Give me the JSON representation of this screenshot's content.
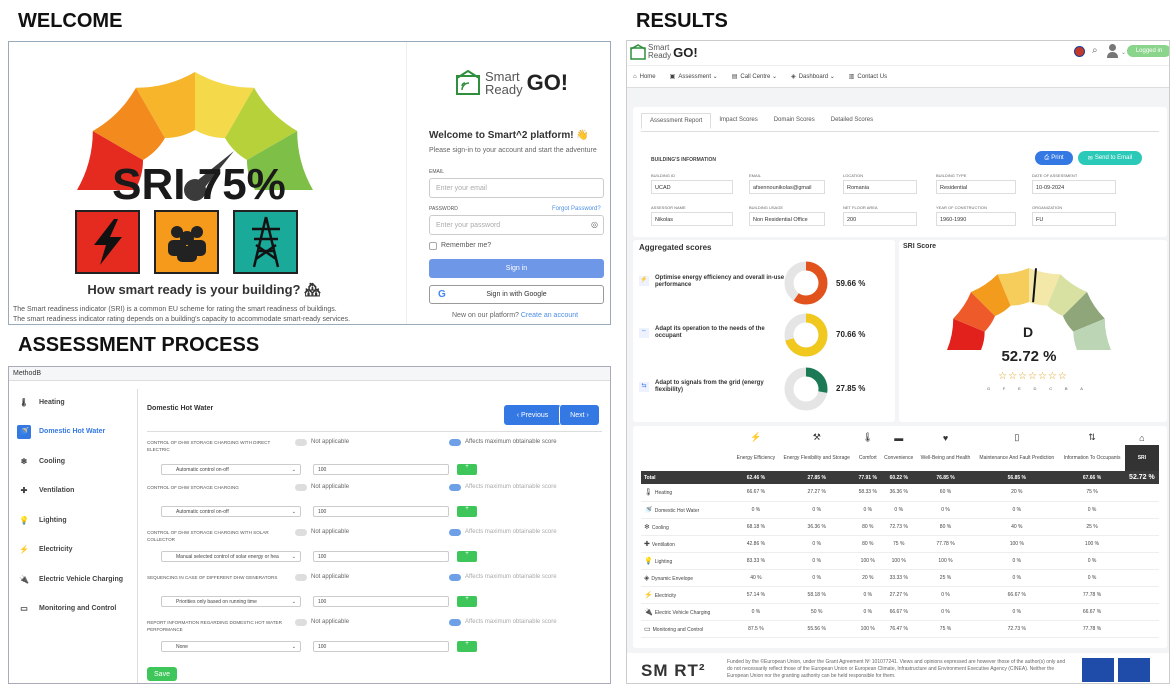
{
  "sections": {
    "welcome": "WELCOME",
    "assessment": "ASSESSMENT PROCESS",
    "results": "RESULTS"
  },
  "welcome": {
    "sri_label": "SRI 75%",
    "sri_value": 0.75,
    "question": "How smart ready is your building? 🏘",
    "caption1": "The Smart readiness indicator (SRI) is a common EU scheme for rating the smart readiness of buildings.",
    "caption2": "The smart readiness indicator rating depends on a building's capacity to accommodate smart-ready services.",
    "logo_smart": "Smart",
    "logo_ready": "Ready",
    "logo_go": "GO!",
    "heading": "Welcome to Smart^2 platform! 👋",
    "subheading": "Please sign-in to your account and start the adventure",
    "email_label": "EMAIL",
    "email_placeholder": "Enter your email",
    "password_label": "PASSWORD",
    "forgot": "Forgot Password?",
    "password_placeholder": "Enter your password",
    "remember": "Remember me?",
    "signin": "Sign in",
    "google": "Sign in with Google",
    "new_text": "New on our platform?",
    "create": "Create an account",
    "colors": {
      "red": "#e52b1f",
      "orange": "#f59a1b",
      "teal": "#1aaa9a",
      "blue": "#4d8ee8"
    }
  },
  "assessment": {
    "method": "MethodB",
    "sidebar": [
      "Heating",
      "Domestic Hot Water",
      "Cooling",
      "Ventilation",
      "Lighting",
      "Electricity",
      "Electric Vehicle Charging",
      "Monitoring and Control"
    ],
    "active_index": 1,
    "domain_title": "Domestic Hot Water",
    "prev": "‹ Previous",
    "next": "Next ›",
    "questions": [
      {
        "label": "CONTROL OF DHW STORAGE CHARGING WITH DIRECT ELECTRIC",
        "select": "Automatic control on-off",
        "value": "100"
      },
      {
        "label": "CONTROL OF DHW STORAGE CHARGING",
        "select": "Automatic control on-off",
        "value": "100"
      },
      {
        "label": "CONTROL OF DHW STORAGE CHARGING WITH SOLAR COLLECTOR",
        "select": "Manual selected control of solar energy or hea",
        "value": "100"
      },
      {
        "label": "SEQUENCING IN CASE OF DIFFERENT DHW GENERATORS",
        "select": "Priorities only based on running time",
        "value": "100"
      },
      {
        "label": "REPORT INFORMATION REGARDING DOMESTIC HOT WATER PERFORMANCE",
        "select": "None",
        "value": "100"
      }
    ],
    "not_applicable": "Not applicable",
    "affects": "Affects maximum obtainable score",
    "save": "Save"
  },
  "results": {
    "logo_smart": "Smart",
    "logo_ready": "Ready",
    "logo_go": "GO!",
    "logged_in": "Logged in",
    "nav": [
      "Home",
      "Assessment ⌄",
      "Call Centre ⌄",
      "Dashboard ⌄",
      "Contact Us"
    ],
    "tabs": [
      "Assessment Report",
      "Impact Scores",
      "Domain Scores",
      "Detailed Scores"
    ],
    "building_info_title": "BUILDING'S INFORMATION",
    "print": "Print",
    "send": "Send to Email",
    "fields": [
      {
        "label": "BUILDING ID",
        "value": "UCAD"
      },
      {
        "label": "EMAIL",
        "value": "afsennounikolas@gmail"
      },
      {
        "label": "LOCATION",
        "value": "Romania"
      },
      {
        "label": "BUILDING TYPE",
        "value": "Residential"
      },
      {
        "label": "DATE OF ASSESSMENT",
        "value": "10-09-2024"
      },
      {
        "label": "ASSESSOR NAME",
        "value": "Nikolas"
      },
      {
        "label": "BUILDING USAGE",
        "value": "Non Residential Office"
      },
      {
        "label": "NET FLOOR AREA",
        "value": "200"
      },
      {
        "label": "YEAR OF CONSTRUCTION",
        "value": "1960-1990"
      },
      {
        "label": "ORGANIZATION",
        "value": "FU"
      }
    ],
    "aggregated_title": "Aggregated scores",
    "aggregated": [
      {
        "label": "Optimise energy efficiency and overall in-use performance",
        "value": 59.66,
        "text": "59.66 %",
        "color": "#e2521c"
      },
      {
        "label": "Adapt its operation to the needs of the occupant",
        "value": 70.66,
        "text": "70.66 %",
        "color": "#f0c81e"
      },
      {
        "label": "Adapt to signals from the grid (energy flexibility)",
        "value": 27.85,
        "text": "27.85 %",
        "color": "#1b7a55"
      }
    ],
    "sri_title": "SRI Score",
    "sri_class": "D",
    "sri_value": 52.72,
    "sri_text": "52.72 %",
    "stars": "☆☆☆☆☆☆☆",
    "star_letters": [
      "G",
      "F",
      "E",
      "D",
      "C",
      "B",
      "A"
    ],
    "table_headers": [
      "Energy Efficiency",
      "Energy Flexibility and Storage",
      "Comfort",
      "Convenience",
      "Well-Being and Health",
      "Maintenance And Fault Prediction",
      "Information To Occupants",
      "SRI"
    ],
    "total_row": [
      "Total",
      "62.46 %",
      "27.85 %",
      "77.91 %",
      "60.22 %",
      "76.85 %",
      "56.85 %",
      "67.66 %",
      "52.72 %"
    ],
    "rows": [
      [
        "Heating",
        "66.67 %",
        "27.27 %",
        "58.33 %",
        "36.36 %",
        "60 %",
        "20 %",
        "75 %"
      ],
      [
        "Domestic Hot Water",
        "0 %",
        "0 %",
        "0 %",
        "0 %",
        "0 %",
        "0 %",
        "0 %"
      ],
      [
        "Cooling",
        "68.18 %",
        "36.36 %",
        "80 %",
        "72.73 %",
        "80 %",
        "40 %",
        "25 %"
      ],
      [
        "Ventilation",
        "42.86 %",
        "0 %",
        "80 %",
        "75 %",
        "77.78 %",
        "100 %",
        "100 %"
      ],
      [
        "Lighting",
        "83.33 %",
        "0 %",
        "100 %",
        "100 %",
        "100 %",
        "0 %",
        "0 %"
      ],
      [
        "Dynamic Envelope",
        "40 %",
        "0 %",
        "20 %",
        "33.33 %",
        "25 %",
        "0 %",
        "0 %"
      ],
      [
        "Electricity",
        "57.14 %",
        "58.18 %",
        "0 %",
        "27.27 %",
        "0 %",
        "66.67 %",
        "77.78 %"
      ],
      [
        "Electric Vehicle Charging",
        "0 %",
        "50 %",
        "0 %",
        "66.67 %",
        "0 %",
        "0 %",
        "66.67 %"
      ],
      [
        "Monitoring and Control",
        "87.5 %",
        "55.56 %",
        "100 %",
        "76.47 %",
        "75 %",
        "72.73 %",
        "77.78 %"
      ]
    ],
    "footer_logo": "SM RT²",
    "footer_text": "Funded by the ©European Union, under the Grant Agreement Nº 101077241. Views and opinions expressed are however those of the author(s) only and do not necessarily reflect those of the European Union or European Climate, Infrastructure and Environment Executive Agency (CINEA). Neither the European Union nor the granting authority can be held responsible for them."
  }
}
